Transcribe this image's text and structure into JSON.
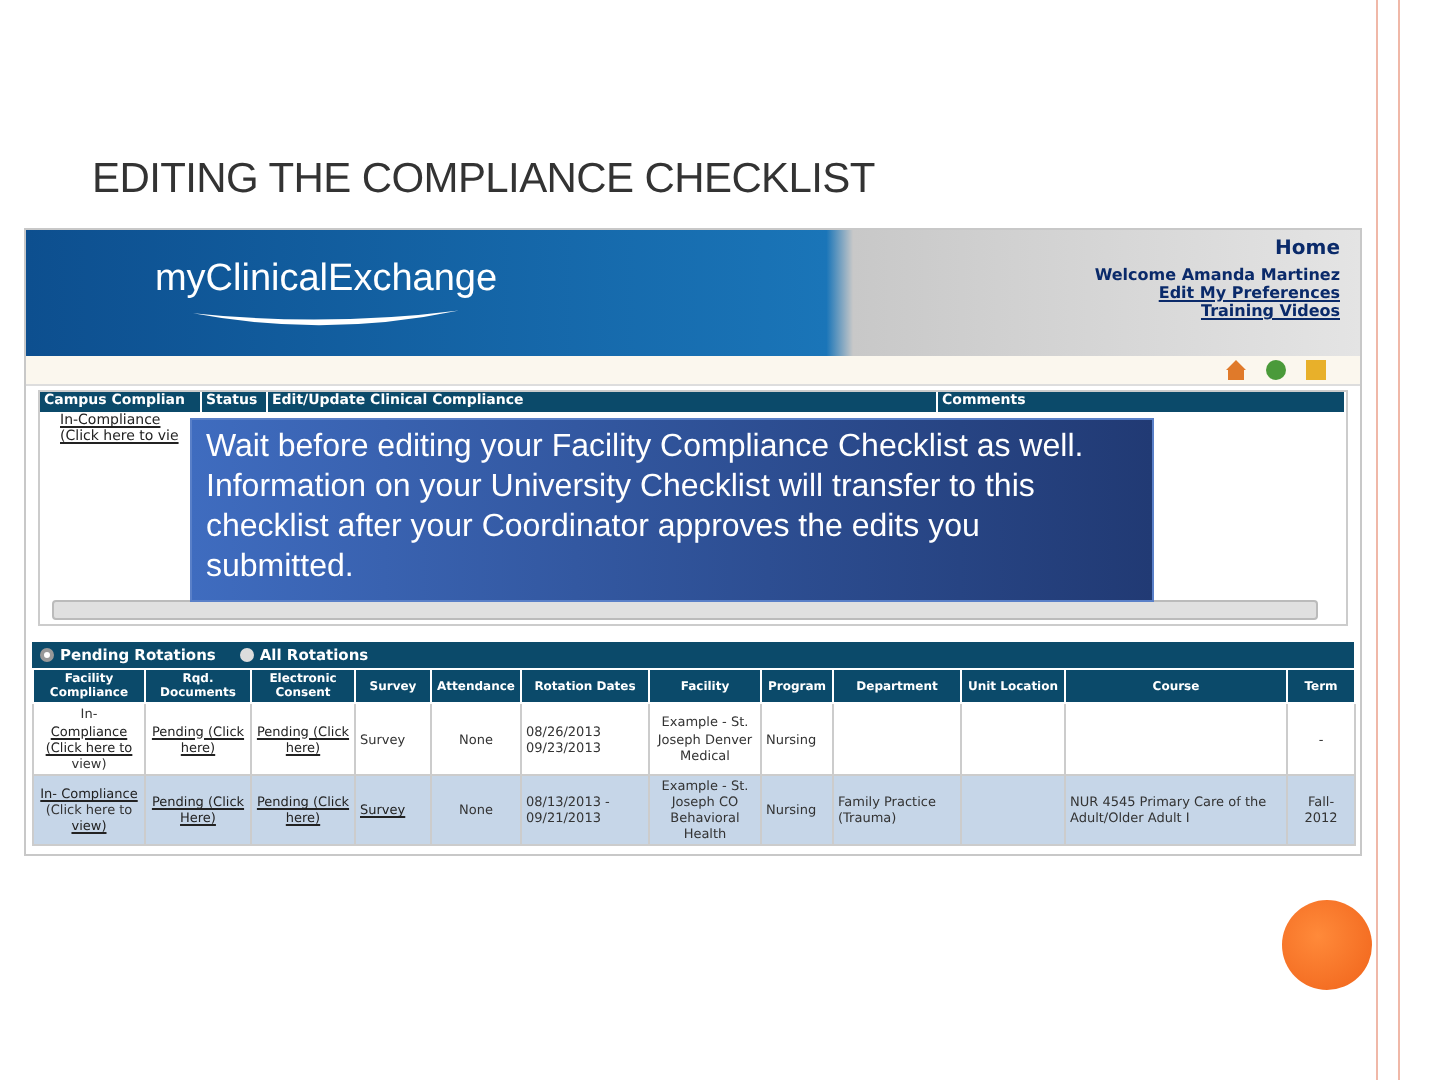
{
  "slide_title": "EDITING THE COMPLIANCE CHECKLIST",
  "header": {
    "logo": "myClinicalExchange",
    "home": "Home",
    "welcome": "Welcome Amanda Martinez",
    "links": [
      "Edit My Preferences",
      "Training Videos"
    ]
  },
  "campus_table": {
    "columns": [
      "Campus Complian",
      "Status",
      "Edit/Update Clinical Compliance",
      "Comments"
    ],
    "rows": [
      [
        [
          "In-Compliance",
          "(Click here to vie"
        ]
      ]
    ]
  },
  "callout": "Wait before editing your Facility Compliance Checklist as well.   Information on your University Checklist will transfer to this checklist after your Coordinator approves the edits you submitted.",
  "filters": [
    {
      "label": "Pending Rotations",
      "selected": true
    },
    {
      "label": "All Rotations",
      "selected": false
    }
  ],
  "rotations": {
    "columns": [
      "Facility Compliance",
      "Rqd. Documents",
      "Electronic Consent",
      "Survey",
      "Attendance",
      "Rotation Dates",
      "Facility",
      "Program",
      "Department",
      "Unit Location",
      "Course",
      "Term"
    ],
    "rows": [
      {
        "cells": [
          {
            "text": "In-",
            "kind": "text"
          },
          {
            "text": "Compliance (Click here to",
            "kind": "link"
          },
          {
            "text": "view)",
            "kind": "text"
          }
        ],
        "docs": "Pending (Click here)",
        "consent": "Pending (Click here)",
        "survey": {
          "text": "Survey",
          "kind": "text"
        },
        "attendance": "None",
        "dates": "08/26/2013 09/23/2013",
        "facility": "Example - St. Joseph Denver Medical",
        "program": "Nursing",
        "department": "",
        "unit": "",
        "course": "",
        "term": "-"
      },
      {
        "cells": [
          {
            "text": "In- Compliance",
            "kind": "link"
          },
          {
            "text": "(Click here to",
            "kind": "text"
          },
          {
            "text": "view)",
            "kind": "link"
          }
        ],
        "docs": "Pending (Click Here)",
        "consent": "Pending (Click here)",
        "survey": {
          "text": "Survey",
          "kind": "link"
        },
        "attendance": "None",
        "dates": "08/13/2013 - 09/21/2013",
        "facility": "Example - St. Joseph CO Behavioral Health",
        "program": "Nursing",
        "department": "Family Practice (Trauma)",
        "unit": "",
        "course": "NUR 4545 Primary Care of the Adult/Older Adult I",
        "term": "Fall-2012"
      }
    ]
  }
}
